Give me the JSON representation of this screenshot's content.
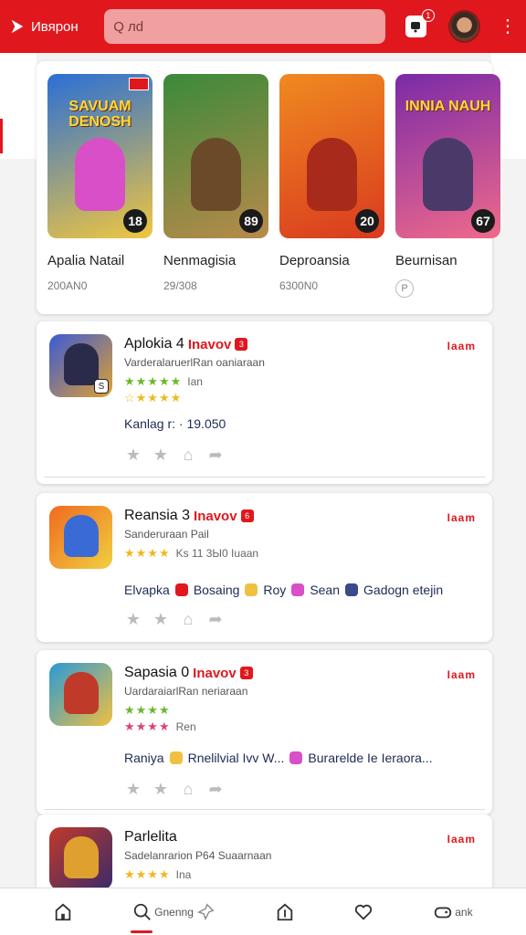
{
  "header": {
    "brand": "Ивярон",
    "search_placeholder": "Q лd",
    "notif_count": "1"
  },
  "featured": [
    {
      "title": "Apalia Natail",
      "sub": "200ΑΝ0",
      "score": "18",
      "art_text": "SAVUAM DENOSH",
      "bg1": "#2a6fd6",
      "bg2": "#f0c640",
      "fig": "#d94fc7"
    },
    {
      "title": "Nenmagisia",
      "sub": "29/308",
      "score": "89",
      "art_text": "",
      "bg1": "#3b8a3a",
      "bg2": "#b88a4a",
      "fig": "#6b4a2a"
    },
    {
      "title": "Deproansia",
      "sub": "6300N0",
      "score": "20",
      "art_text": "",
      "bg1": "#f08a20",
      "bg2": "#d93a1f",
      "fig": "#a82a1a"
    },
    {
      "title": "Beurnisan",
      "sub": "P",
      "score": "67",
      "art_text": "INNIA NAUH",
      "bg1": "#7a2aa8",
      "bg2": "#f06a8a",
      "fig": "#4a3a6a"
    }
  ],
  "apps": [
    {
      "name": "Aplokia 4",
      "tag": "Inavov",
      "tag_num": "3",
      "more": "Iaam",
      "developer": "VarderalaruerlRan oaniaraan",
      "stars1": "★★★★★",
      "meta1": "Ian",
      "stars2": "☆★★★★",
      "info": "Kanlag r: · 19.050",
      "badge": "S",
      "icon_bg1": "#3a5ad6",
      "icon_bg2": "#e0a030",
      "icon_fig": "#2a2a4a"
    },
    {
      "name": "Reansia 3",
      "tag": "Inavov",
      "tag_num": "6",
      "more": "Iaam",
      "developer": "Sanderuraan Pail",
      "stars1": "★★★★",
      "meta1": "Ks 11 3Ы0 Iuaan",
      "stars2": "",
      "info_items": [
        "Elvapka",
        "Bosaing",
        "Roy",
        "Sean",
        "Gadogn etejin"
      ],
      "info_chip_colors": [
        "#e0181e",
        "#e0181e",
        "#f0c040",
        "#d94fc7",
        "#3a4a8a"
      ],
      "icon_bg1": "#f06a20",
      "icon_bg2": "#f0d040",
      "icon_fig": "#3a6ad6"
    },
    {
      "name": "Sapasia 0",
      "tag": "Inavov",
      "tag_num": "3",
      "more": "Iaam",
      "developer": "UardaraiarlRan neriaraan",
      "stars1": "★★★★",
      "meta1": "",
      "stars2": "★★★★",
      "meta2": "Ren",
      "info_items": [
        "Raniya",
        "Rnelilvial Ivv W...",
        "Burarelde Ie Ieraora..."
      ],
      "info_chip_colors": [
        "#f0c040",
        "#f0c040",
        "#d94fc7"
      ],
      "icon_bg1": "#2a9ad6",
      "icon_bg2": "#f0c040",
      "icon_fig": "#c03a2a"
    },
    {
      "name": "Parlelita",
      "tag": "",
      "tag_num": "",
      "more": "Iaam",
      "developer": "Sadelanrarion P64 Suaarnaan",
      "stars1": "★★★★",
      "meta1": "Ina",
      "icon_bg1": "#c03a2a",
      "icon_bg2": "#3a2a6a",
      "icon_fig": "#e0a030"
    }
  ],
  "nav": {
    "items": [
      "",
      "Gnenng",
      "",
      "",
      "ank"
    ]
  },
  "colors": {
    "accent": "#e0181e",
    "star_gold": "#f0b820",
    "star_green": "#6ab82a",
    "star_pink": "#e0407a"
  }
}
